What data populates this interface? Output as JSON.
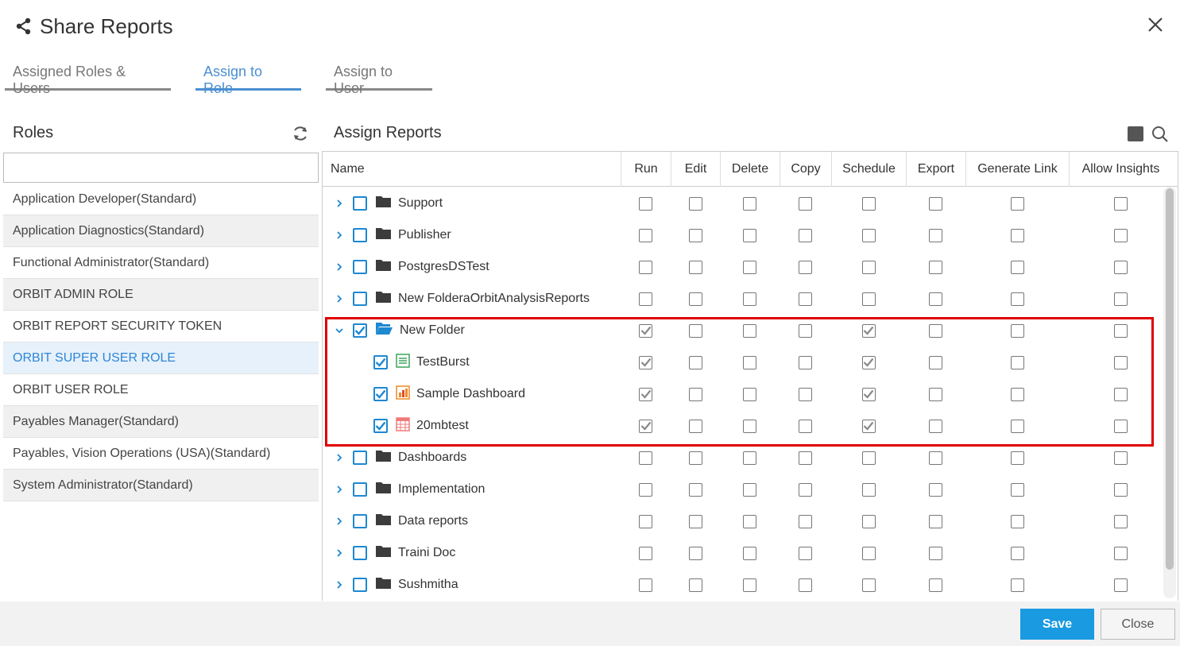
{
  "dialog": {
    "title": "Share Reports"
  },
  "tabs": [
    {
      "label": "Assigned Roles & Users",
      "active": false
    },
    {
      "label": "Assign to Role",
      "active": true
    },
    {
      "label": "Assign to User",
      "active": false
    }
  ],
  "roles": {
    "title": "Roles",
    "search_value": "",
    "items": [
      {
        "label": "Application Developer(Standard)",
        "selected": false
      },
      {
        "label": "Application Diagnostics(Standard)",
        "selected": false
      },
      {
        "label": "Functional Administrator(Standard)",
        "selected": false
      },
      {
        "label": "ORBIT ADMIN ROLE",
        "selected": false
      },
      {
        "label": "ORBIT REPORT SECURITY TOKEN",
        "selected": false
      },
      {
        "label": "ORBIT SUPER USER ROLE",
        "selected": true
      },
      {
        "label": "ORBIT USER ROLE",
        "selected": false
      },
      {
        "label": "Payables Manager(Standard)",
        "selected": false
      },
      {
        "label": "Payables, Vision Operations (USA)(Standard)",
        "selected": false
      },
      {
        "label": "System Administrator(Standard)",
        "selected": false
      }
    ]
  },
  "assign": {
    "title": "Assign Reports",
    "columns": [
      "Name",
      "Run",
      "Edit",
      "Delete",
      "Copy",
      "Schedule",
      "Export",
      "Generate Link",
      "Allow Insights"
    ],
    "rows": [
      {
        "name": "Support",
        "type": "folder",
        "expanded": false,
        "level": 0,
        "checked": false,
        "perms": [
          false,
          false,
          false,
          false,
          false,
          false,
          false,
          false
        ]
      },
      {
        "name": "Publisher",
        "type": "folder",
        "expanded": false,
        "level": 0,
        "checked": false,
        "perms": [
          false,
          false,
          false,
          false,
          false,
          false,
          false,
          false
        ]
      },
      {
        "name": "PostgresDSTest",
        "type": "folder",
        "expanded": false,
        "level": 0,
        "checked": false,
        "perms": [
          false,
          false,
          false,
          false,
          false,
          false,
          false,
          false
        ]
      },
      {
        "name": "New FolderaOrbitAnalysisReports",
        "type": "folder",
        "expanded": false,
        "level": 0,
        "checked": false,
        "perms": [
          false,
          false,
          false,
          false,
          false,
          false,
          false,
          false
        ]
      },
      {
        "name": "New Folder",
        "type": "folder-open",
        "expanded": true,
        "level": 0,
        "checked": true,
        "perms": [
          true,
          false,
          false,
          false,
          true,
          false,
          false,
          false
        ]
      },
      {
        "name": "TestBurst",
        "type": "report",
        "expanded": false,
        "level": 1,
        "checked": true,
        "perms": [
          true,
          false,
          false,
          false,
          true,
          false,
          false,
          false
        ]
      },
      {
        "name": "Sample Dashboard",
        "type": "dashboard",
        "expanded": false,
        "level": 1,
        "checked": true,
        "perms": [
          true,
          false,
          false,
          false,
          true,
          false,
          false,
          false
        ]
      },
      {
        "name": "20mbtest",
        "type": "table",
        "expanded": false,
        "level": 1,
        "checked": true,
        "perms": [
          true,
          false,
          false,
          false,
          true,
          false,
          false,
          false
        ]
      },
      {
        "name": "Dashboards",
        "type": "folder",
        "expanded": false,
        "level": 0,
        "checked": false,
        "perms": [
          false,
          false,
          false,
          false,
          false,
          false,
          false,
          false
        ]
      },
      {
        "name": "Implementation",
        "type": "folder",
        "expanded": false,
        "level": 0,
        "checked": false,
        "perms": [
          false,
          false,
          false,
          false,
          false,
          false,
          false,
          false
        ]
      },
      {
        "name": "Data reports",
        "type": "folder",
        "expanded": false,
        "level": 0,
        "checked": false,
        "perms": [
          false,
          false,
          false,
          false,
          false,
          false,
          false,
          false
        ]
      },
      {
        "name": "Traini Doc",
        "type": "folder",
        "expanded": false,
        "level": 0,
        "checked": false,
        "perms": [
          false,
          false,
          false,
          false,
          false,
          false,
          false,
          false
        ]
      },
      {
        "name": "Sushmitha",
        "type": "folder",
        "expanded": false,
        "level": 0,
        "checked": false,
        "perms": [
          false,
          false,
          false,
          false,
          false,
          false,
          false,
          false
        ]
      }
    ]
  },
  "footer": {
    "save_label": "Save",
    "close_label": "Close"
  },
  "colors": {
    "accent": "#1a9ae0",
    "tab_active": "#4a8fd1",
    "highlight": "#e00000",
    "checkbox_blue": "#1e88d0"
  }
}
